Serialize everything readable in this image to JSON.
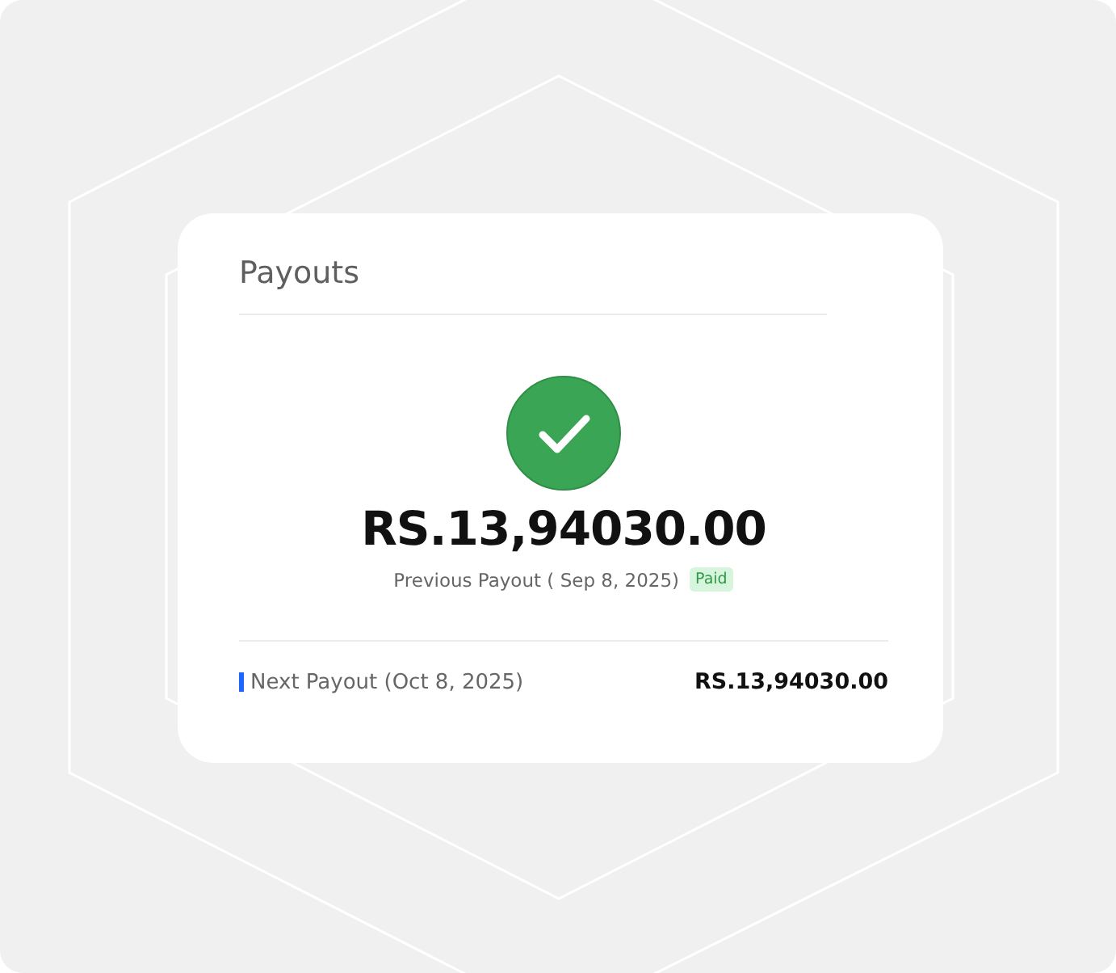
{
  "card": {
    "title": "Payouts",
    "succeeded": true,
    "amount": "RS.13,94030.00",
    "previous": {
      "label": "Previous Payout ( Sep 8, 2025)",
      "badge": "Paid"
    },
    "next": {
      "label": "Next Payout (Oct 8, 2025)",
      "amount": "RS.13,94030.00"
    }
  }
}
